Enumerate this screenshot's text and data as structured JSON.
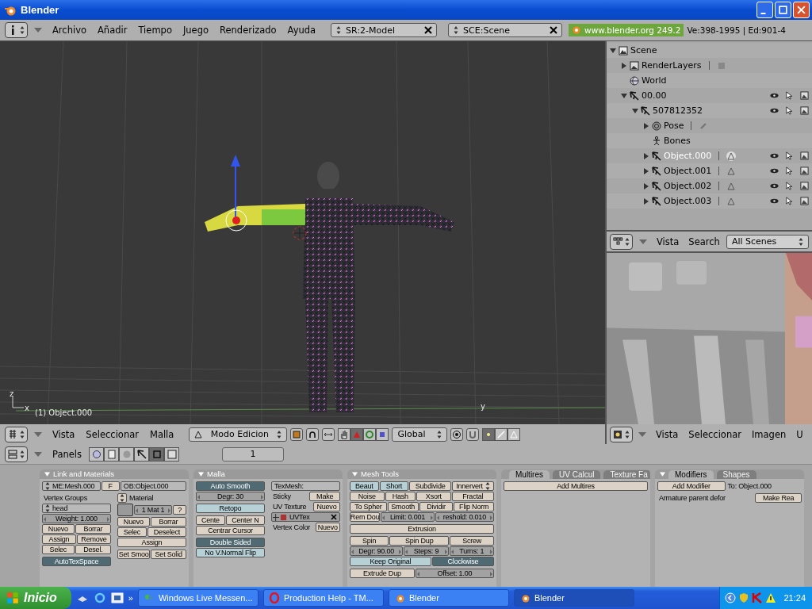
{
  "window": {
    "title": "Blender"
  },
  "top_header": {
    "menus": [
      "Archivo",
      "Añadir",
      "Tiempo",
      "Juego",
      "Renderizado",
      "Ayuda"
    ],
    "screen": "SR:2-Model",
    "scene": "SCE:Scene",
    "version": "www.blender.org 249.2",
    "stats": "Ve:398-1995 | Ed:901-4"
  },
  "viewport": {
    "object_label": "(1) Object.000",
    "grid_axis": "y",
    "gizmo_axes": [
      "z",
      "x"
    ]
  },
  "viewport_header": {
    "menus": [
      "Vista",
      "Seleccionar",
      "Malla"
    ],
    "mode": "Modo Edicion",
    "orientation": "Global",
    "manipulators": [
      {
        "kind": "hand",
        "selected": false
      },
      {
        "kind": "translate",
        "selected": true
      },
      {
        "kind": "rotate",
        "selected": false
      },
      {
        "kind": "scale",
        "selected": false
      }
    ],
    "select_modes": [
      {
        "kind": "vertex",
        "selected": true
      },
      {
        "kind": "edge",
        "selected": false
      },
      {
        "kind": "face",
        "selected": false
      }
    ]
  },
  "outliner": {
    "items": [
      {
        "name": "Scene",
        "kind": "scene",
        "expanded": true,
        "selected": false,
        "children": [
          {
            "name": "RenderLayers",
            "kind": "renderlayers",
            "expanded": false,
            "selected": false
          },
          {
            "name": "World",
            "kind": "world",
            "selected": false
          },
          {
            "name": "00.00",
            "kind": "armature",
            "expanded": true,
            "selected": false,
            "children": [
              {
                "name": "507812352",
                "kind": "armature",
                "expanded": true,
                "selected": false,
                "children": [
                  {
                    "name": "Pose",
                    "kind": "pose",
                    "expanded": false,
                    "selected": false
                  },
                  {
                    "name": "Bones",
                    "kind": "bones",
                    "selected": false
                  },
                  {
                    "name": "Object.000",
                    "kind": "object",
                    "expanded": false,
                    "selected": true
                  },
                  {
                    "name": "Object.001",
                    "kind": "object",
                    "expanded": false,
                    "selected": false
                  },
                  {
                    "name": "Object.002",
                    "kind": "object",
                    "expanded": false,
                    "selected": false
                  },
                  {
                    "name": "Object.003",
                    "kind": "object",
                    "expanded": false,
                    "selected": false
                  }
                ]
              }
            ]
          }
        ]
      }
    ]
  },
  "outliner_header": {
    "menus": [
      "Vista",
      "Search"
    ],
    "filter": "All Scenes"
  },
  "image_header": {
    "menus": [
      "Vista",
      "Seleccionar",
      "Imagen",
      "U"
    ]
  },
  "buttons_header": {
    "label": "Panels",
    "contexts": [
      {
        "kind": "logic",
        "selected": false
      },
      {
        "kind": "script",
        "selected": false
      },
      {
        "kind": "shading",
        "selected": false
      },
      {
        "kind": "object",
        "selected": false
      },
      {
        "kind": "editing",
        "selected": true
      },
      {
        "kind": "scene",
        "selected": false
      }
    ],
    "frame": "1"
  },
  "buttons_window": {
    "panels": [
      {
        "title": "Link and Materials",
        "rows": [
          [
            {
              "kind": "menu_field",
              "label": "ME:Mesh.000"
            },
            {
              "kind": "button",
              "label": "F"
            },
            {
              "kind": "field",
              "label": "OB:Object.000"
            }
          ]
        ],
        "stacks": [
          [
            [
              [
                {
                  "kind": "label",
                  "label": "Vertex Groups"
                }
              ],
              [
                {
                  "kind": "menu_field",
                  "label": "head"
                }
              ],
              [
                {
                  "kind": "num",
                  "label": "Weight: 1.000"
                }
              ],
              [
                {
                  "kind": "button",
                  "label": "Nuevo"
                },
                {
                  "kind": "button",
                  "label": "Borrar"
                }
              ],
              [
                {
                  "kind": "button",
                  "label": "Assign"
                },
                {
                  "kind": "button",
                  "label": "Remove"
                }
              ],
              [
                {
                  "kind": "button",
                  "label": "Selec"
                },
                {
                  "kind": "button",
                  "label": "Desel."
                }
              ]
            ],
            [
              [
                {
                  "kind": "toggle",
                  "label": "AutoTexSpace",
                  "on": true
                }
              ]
            ]
          ],
          [
            [
              [
                {
                  "kind": "menu"
                },
                {
                  "kind": "label",
                  "label": "Material"
                }
              ],
              [
                {
                  "kind": "swatch"
                },
                {
                  "kind": "num",
                  "label": "1 Mat 1"
                },
                {
                  "kind": "button",
                  "label": "?"
                }
              ],
              [
                {
                  "kind": "button",
                  "label": "Nuevo"
                },
                {
                  "kind": "button",
                  "label": "Borrar"
                }
              ],
              [
                {
                  "kind": "button",
                  "label": "Selec"
                },
                {
                  "kind": "button",
                  "label": "Deselect"
                }
              ],
              [
                {
                  "kind": "button",
                  "label": "Assign"
                }
              ]
            ],
            [
              [
                {
                  "kind": "button",
                  "label": "Set Smoo"
                },
                {
                  "kind": "button",
                  "label": "Set Solid"
                }
              ]
            ]
          ]
        ]
      },
      {
        "title": "Malla",
        "stacks": [
          [
            [
              [
                {
                  "kind": "toggle",
                  "label": "Auto Smooth",
                  "on": true
                }
              ],
              [
                {
                  "kind": "num",
                  "label": "Degr: 30"
                }
              ]
            ],
            [
              [
                {
                  "kind": "toggle",
                  "label": "Retopo",
                  "on": false
                }
              ]
            ],
            [
              [
                {
                  "kind": "button",
                  "label": "Cente"
                },
                {
                  "kind": "button",
                  "label": "Center N"
                }
              ],
              [
                {
                  "kind": "button",
                  "label": "Centrar Cursor"
                }
              ]
            ],
            [
              [
                {
                  "kind": "toggle",
                  "label": "Double Sided",
                  "on": true
                }
              ],
              [
                {
                  "kind": "toggle",
                  "label": "No V.Normal Flip",
                  "on": false
                }
              ]
            ]
          ],
          [
            [
              [
                {
                  "kind": "field",
                  "label": "TexMesh:"
                }
              ],
              [
                {
                  "kind": "label",
                  "label": "Sticky"
                },
                {
                  "kind": "button",
                  "label": "Make"
                }
              ],
              [
                {
                  "kind": "label",
                  "label": "UV Texture"
                },
                {
                  "kind": "button",
                  "label": "Nuevo"
                }
              ],
              [
                {
                  "kind": "layer",
                  "label": "UVTex"
                }
              ],
              [
                {
                  "kind": "label",
                  "label": "Vertex Color"
                },
                {
                  "kind": "button",
                  "label": "Nuevo"
                }
              ]
            ]
          ]
        ]
      },
      {
        "title": "Mesh Tools",
        "stacks": [
          [
            [
              [
                {
                  "kind": "toggle",
                  "label": "Beaut",
                  "on": false
                },
                {
                  "kind": "toggle",
                  "label": "Short",
                  "on": false
                },
                {
                  "kind": "button",
                  "label": "Subdivide"
                },
                {
                  "kind": "menu_button",
                  "label": "Innervert"
                }
              ],
              [
                {
                  "kind": "button",
                  "label": "Noise"
                },
                {
                  "kind": "button",
                  "label": "Hash"
                },
                {
                  "kind": "button",
                  "label": "Xsort"
                },
                {
                  "kind": "button",
                  "label": "Fractal"
                }
              ],
              [
                {
                  "kind": "button",
                  "label": "To Spher"
                },
                {
                  "kind": "button",
                  "label": "Smooth"
                },
                {
                  "kind": "button",
                  "label": "Dividir"
                },
                {
                  "kind": "button",
                  "label": "Flip Norm"
                }
              ],
              [
                {
                  "kind": "button",
                  "label": "Rem Dou"
                },
                {
                  "kind": "num",
                  "label": "Limit: 0.001"
                },
                {
                  "kind": "num",
                  "label": "reshold: 0.010"
                }
              ]
            ],
            [
              [
                {
                  "kind": "button",
                  "label": "Extrusion"
                }
              ]
            ],
            [
              [
                {
                  "kind": "button",
                  "label": "Spin"
                },
                {
                  "kind": "button",
                  "label": "Spin Dup"
                },
                {
                  "kind": "button",
                  "label": "Screw"
                }
              ],
              [
                {
                  "kind": "num",
                  "label": "Degr: 90.00"
                },
                {
                  "kind": "num",
                  "label": "Steps: 9"
                },
                {
                  "kind": "num",
                  "label": "Turns: 1"
                }
              ],
              [
                {
                  "kind": "toggle",
                  "label": "Keep Original",
                  "on": false
                },
                {
                  "kind": "toggle",
                  "label": "Clockwise",
                  "on": true
                }
              ]
            ],
            [
              [
                {
                  "kind": "button",
                  "label": "Extrude Dup"
                },
                {
                  "kind": "num",
                  "label": "Offset: 1.00"
                }
              ]
            ]
          ]
        ]
      },
      {
        "tabs": [
          {
            "label": "Multires",
            "selected": true
          },
          {
            "label": "UV Calcul",
            "selected": false
          },
          {
            "label": "Texture Fa",
            "selected": false
          }
        ],
        "stacks": [
          [
            [
              [
                {
                  "kind": "button",
                  "label": "Add Multires"
                }
              ]
            ]
          ]
        ]
      },
      {
        "tabs": [
          {
            "label": "Modifiers",
            "selected": true
          },
          {
            "label": "Shapes",
            "selected": false
          }
        ],
        "stacks": [
          [
            [
              [
                {
                  "kind": "button",
                  "label": "Add Modifier"
                },
                {
                  "kind": "label",
                  "label": "To: Object.000"
                }
              ]
            ],
            [
              [
                {
                  "kind": "label",
                  "label": "Armature parent defor"
                },
                {
                  "kind": "button",
                  "label": "Make Rea"
                }
              ]
            ]
          ]
        ]
      }
    ]
  },
  "taskbar": {
    "start": "Inicio",
    "more": "»",
    "tasks": [
      {
        "label": "Windows Live Messen...",
        "kind": "messenger",
        "selected": false
      },
      {
        "label": "Production Help - TM...",
        "kind": "opera",
        "selected": false
      },
      {
        "label": "Blender",
        "kind": "blender",
        "selected": false
      },
      {
        "label": "Blender",
        "kind": "blender",
        "selected": true
      }
    ],
    "clock": "21:24"
  }
}
